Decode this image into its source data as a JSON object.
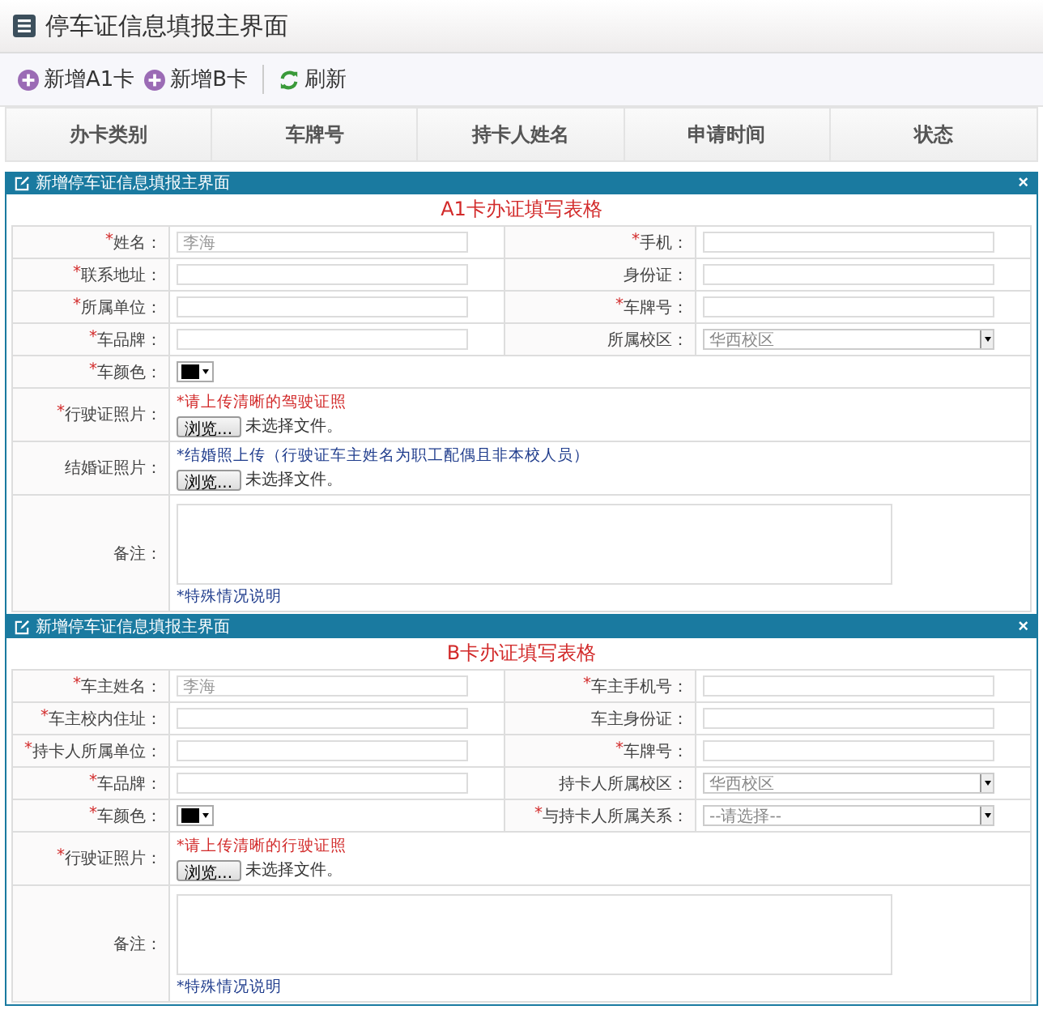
{
  "page": {
    "title": "停车证信息填报主界面"
  },
  "toolbar": [
    {
      "kind": "add",
      "label": "新增A1卡"
    },
    {
      "kind": "add",
      "label": "新增B卡"
    },
    {
      "kind": "refresh",
      "label": "刷新"
    }
  ],
  "table": {
    "columns": [
      "办卡类别",
      "车牌号",
      "持卡人姓名",
      "申请时间",
      "状态"
    ]
  },
  "dialogs": [
    {
      "title": "新增停车证信息填报主界面",
      "close": "×",
      "heading": "A1卡办证填写表格",
      "fields": [
        {
          "kind": "text",
          "mark": "*",
          "label": "姓名：",
          "placeholder": "李海"
        },
        {
          "kind": "text",
          "mark": "*",
          "label": "手机："
        },
        {
          "kind": "text",
          "mark": "*",
          "label": "联系地址："
        },
        {
          "kind": "text",
          "label": "身份证："
        },
        {
          "kind": "text",
          "mark": "*",
          "label": "所属单位："
        },
        {
          "kind": "text",
          "mark": "*",
          "label": "车牌号："
        },
        {
          "kind": "text",
          "mark": "*",
          "label": "车品牌："
        },
        {
          "kind": "select",
          "label": "所属校区：",
          "value": "华西校区"
        },
        {
          "kind": "color",
          "mark": "*",
          "label": "车颜色：",
          "color": "#000000",
          "wide": true
        }
      ],
      "uploads": [
        {
          "mark": "*",
          "label": "行驶证照片：",
          "hint": "*请上传清晰的驾驶证照",
          "kind": "warning",
          "button": "浏览...",
          "status": "未选择文件。"
        },
        {
          "label": "结婚证照片：",
          "hint": "*结婚照上传（行驶证车主姓名为职工配偶且非本校人员）",
          "kind": "note",
          "button": "浏览...",
          "status": "未选择文件。"
        }
      ],
      "remarks": {
        "label": "备注：",
        "hint": "*特殊情况说明"
      }
    },
    {
      "title": "新增停车证信息填报主界面",
      "close": "×",
      "heading": "B卡办证填写表格",
      "fields": [
        {
          "kind": "text",
          "mark": "*",
          "label": "车主姓名：",
          "placeholder": "李海"
        },
        {
          "kind": "text",
          "mark": "*",
          "label": "车主手机号："
        },
        {
          "kind": "text",
          "mark": "*",
          "label": "车主校内住址："
        },
        {
          "kind": "text",
          "label": "车主身份证："
        },
        {
          "kind": "text",
          "mark": "*",
          "label": "持卡人所属单位："
        },
        {
          "kind": "text",
          "mark": "*",
          "label": "车牌号："
        },
        {
          "kind": "text",
          "mark": "*",
          "label": "车品牌："
        },
        {
          "kind": "select",
          "label": "持卡人所属校区：",
          "value": "华西校区"
        },
        {
          "kind": "color",
          "mark": "*",
          "label": "车颜色：",
          "color": "#000000",
          "wide": false
        },
        {
          "kind": "select",
          "mark": "*",
          "label": "与持卡人所属关系：",
          "value": "--请选择--"
        }
      ],
      "uploads": [
        {
          "mark": "*",
          "label": "行驶证照片：",
          "hint": "*请上传清晰的行驶证照",
          "kind": "warning",
          "button": "浏览...",
          "status": "未选择文件。"
        }
      ],
      "remarks": {
        "label": "备注：",
        "hint": "*特殊情况说明"
      }
    }
  ]
}
